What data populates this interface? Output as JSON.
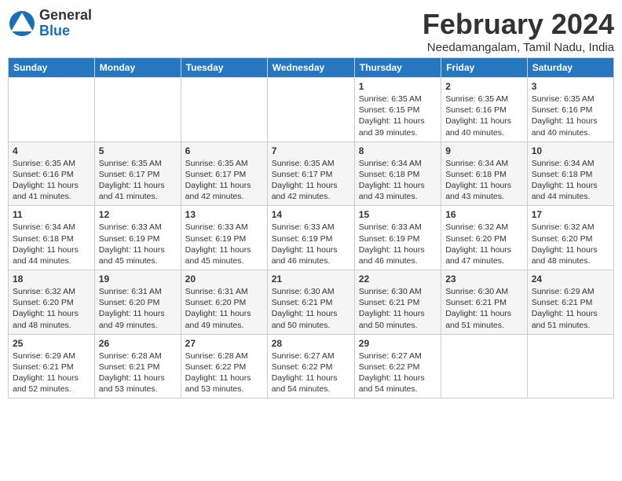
{
  "logo": {
    "general": "General",
    "blue": "Blue"
  },
  "title": "February 2024",
  "subtitle": "Needamangalam, Tamil Nadu, India",
  "days_header": [
    "Sunday",
    "Monday",
    "Tuesday",
    "Wednesday",
    "Thursday",
    "Friday",
    "Saturday"
  ],
  "weeks": [
    [
      {
        "day": "",
        "info": ""
      },
      {
        "day": "",
        "info": ""
      },
      {
        "day": "",
        "info": ""
      },
      {
        "day": "",
        "info": ""
      },
      {
        "day": "1",
        "info": "Sunrise: 6:35 AM\nSunset: 6:15 PM\nDaylight: 11 hours and 39 minutes."
      },
      {
        "day": "2",
        "info": "Sunrise: 6:35 AM\nSunset: 6:16 PM\nDaylight: 11 hours and 40 minutes."
      },
      {
        "day": "3",
        "info": "Sunrise: 6:35 AM\nSunset: 6:16 PM\nDaylight: 11 hours and 40 minutes."
      }
    ],
    [
      {
        "day": "4",
        "info": "Sunrise: 6:35 AM\nSunset: 6:16 PM\nDaylight: 11 hours and 41 minutes."
      },
      {
        "day": "5",
        "info": "Sunrise: 6:35 AM\nSunset: 6:17 PM\nDaylight: 11 hours and 41 minutes."
      },
      {
        "day": "6",
        "info": "Sunrise: 6:35 AM\nSunset: 6:17 PM\nDaylight: 11 hours and 42 minutes."
      },
      {
        "day": "7",
        "info": "Sunrise: 6:35 AM\nSunset: 6:17 PM\nDaylight: 11 hours and 42 minutes."
      },
      {
        "day": "8",
        "info": "Sunrise: 6:34 AM\nSunset: 6:18 PM\nDaylight: 11 hours and 43 minutes."
      },
      {
        "day": "9",
        "info": "Sunrise: 6:34 AM\nSunset: 6:18 PM\nDaylight: 11 hours and 43 minutes."
      },
      {
        "day": "10",
        "info": "Sunrise: 6:34 AM\nSunset: 6:18 PM\nDaylight: 11 hours and 44 minutes."
      }
    ],
    [
      {
        "day": "11",
        "info": "Sunrise: 6:34 AM\nSunset: 6:18 PM\nDaylight: 11 hours and 44 minutes."
      },
      {
        "day": "12",
        "info": "Sunrise: 6:33 AM\nSunset: 6:19 PM\nDaylight: 11 hours and 45 minutes."
      },
      {
        "day": "13",
        "info": "Sunrise: 6:33 AM\nSunset: 6:19 PM\nDaylight: 11 hours and 45 minutes."
      },
      {
        "day": "14",
        "info": "Sunrise: 6:33 AM\nSunset: 6:19 PM\nDaylight: 11 hours and 46 minutes."
      },
      {
        "day": "15",
        "info": "Sunrise: 6:33 AM\nSunset: 6:19 PM\nDaylight: 11 hours and 46 minutes."
      },
      {
        "day": "16",
        "info": "Sunrise: 6:32 AM\nSunset: 6:20 PM\nDaylight: 11 hours and 47 minutes."
      },
      {
        "day": "17",
        "info": "Sunrise: 6:32 AM\nSunset: 6:20 PM\nDaylight: 11 hours and 48 minutes."
      }
    ],
    [
      {
        "day": "18",
        "info": "Sunrise: 6:32 AM\nSunset: 6:20 PM\nDaylight: 11 hours and 48 minutes."
      },
      {
        "day": "19",
        "info": "Sunrise: 6:31 AM\nSunset: 6:20 PM\nDaylight: 11 hours and 49 minutes."
      },
      {
        "day": "20",
        "info": "Sunrise: 6:31 AM\nSunset: 6:20 PM\nDaylight: 11 hours and 49 minutes."
      },
      {
        "day": "21",
        "info": "Sunrise: 6:30 AM\nSunset: 6:21 PM\nDaylight: 11 hours and 50 minutes."
      },
      {
        "day": "22",
        "info": "Sunrise: 6:30 AM\nSunset: 6:21 PM\nDaylight: 11 hours and 50 minutes."
      },
      {
        "day": "23",
        "info": "Sunrise: 6:30 AM\nSunset: 6:21 PM\nDaylight: 11 hours and 51 minutes."
      },
      {
        "day": "24",
        "info": "Sunrise: 6:29 AM\nSunset: 6:21 PM\nDaylight: 11 hours and 51 minutes."
      }
    ],
    [
      {
        "day": "25",
        "info": "Sunrise: 6:29 AM\nSunset: 6:21 PM\nDaylight: 11 hours and 52 minutes."
      },
      {
        "day": "26",
        "info": "Sunrise: 6:28 AM\nSunset: 6:21 PM\nDaylight: 11 hours and 53 minutes."
      },
      {
        "day": "27",
        "info": "Sunrise: 6:28 AM\nSunset: 6:22 PM\nDaylight: 11 hours and 53 minutes."
      },
      {
        "day": "28",
        "info": "Sunrise: 6:27 AM\nSunset: 6:22 PM\nDaylight: 11 hours and 54 minutes."
      },
      {
        "day": "29",
        "info": "Sunrise: 6:27 AM\nSunset: 6:22 PM\nDaylight: 11 hours and 54 minutes."
      },
      {
        "day": "",
        "info": ""
      },
      {
        "day": "",
        "info": ""
      }
    ]
  ]
}
